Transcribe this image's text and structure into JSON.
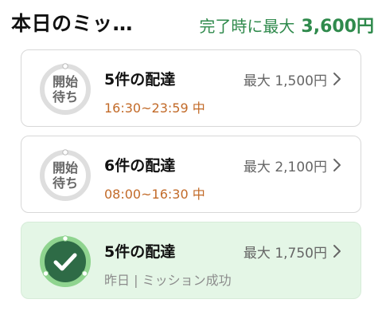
{
  "header": {
    "title": "本日のミッ…",
    "reward_label": "完了時に最大",
    "reward_amount": "3,600円"
  },
  "missions": [
    {
      "status": "開始待ち",
      "status_line1": "開始",
      "status_line2": "待ち",
      "title": "5件の配達",
      "max_reward": "最大 1,500円",
      "subtitle": "16:30~23:59 中"
    },
    {
      "status": "開始待ち",
      "status_line1": "開始",
      "status_line2": "待ち",
      "title": "6件の配達",
      "max_reward": "最大 2,100円",
      "subtitle": "08:00~16:30 中"
    },
    {
      "status": "完了",
      "title": "5件の配達",
      "max_reward": "最大 1,750円",
      "subtitle": "昨日 | ミッション成功"
    }
  ],
  "colors": {
    "reward_green": "#2f8a4c",
    "time_orange": "#c26a28",
    "success_bg": "#e4f6e6",
    "check_dark_green": "#2e6b46",
    "check_ring_green": "#8fd48f"
  },
  "icons": {
    "chevron": "chevron-right-icon",
    "check": "check-icon"
  }
}
